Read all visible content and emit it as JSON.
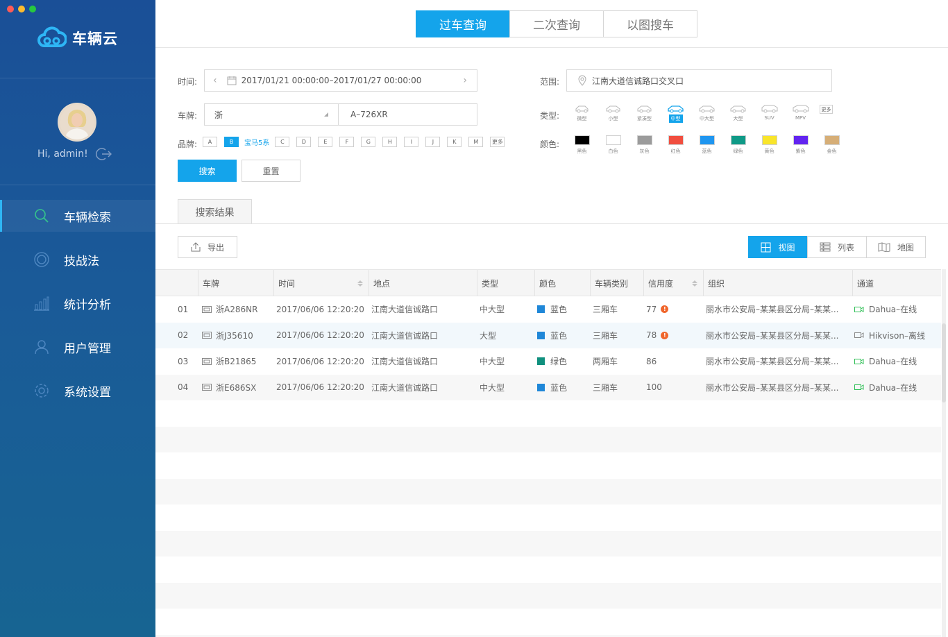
{
  "app": {
    "name": "车辆云"
  },
  "user": {
    "greeting": "Hi, admin!"
  },
  "sidebar": {
    "items": [
      {
        "label": "车辆检索",
        "icon": "search-icon"
      },
      {
        "label": "技战法",
        "icon": "target-icon"
      },
      {
        "label": "统计分析",
        "icon": "bar-chart-icon"
      },
      {
        "label": "用户管理",
        "icon": "users-icon"
      },
      {
        "label": "系统设置",
        "icon": "gear-icon"
      }
    ]
  },
  "tabs": [
    "过车查询",
    "二次查询",
    "以图搜车"
  ],
  "form": {
    "time_label": "时间:",
    "time_value": "2017/01/21 00:00:00–2017/01/27 00:00:00",
    "plate_label": "车牌:",
    "plate_province": "浙",
    "plate_number": "A–726XR",
    "brand_label": "品牌:",
    "brand_letters": [
      "A",
      "B",
      "C",
      "D",
      "E",
      "F",
      "G",
      "H",
      "I",
      "J",
      "K",
      "M"
    ],
    "brand_selected_tag": "宝马5系",
    "brand_more": "更多",
    "range_label": "范围:",
    "range_value": "江南大道信诚路口交叉口",
    "type_label": "类型:",
    "types": [
      "微型",
      "小型",
      "紧凑型",
      "中型",
      "中大型",
      "大型",
      "SUV",
      "MPV"
    ],
    "type_selected": "中型",
    "type_more": "更多",
    "color_label": "颜色:",
    "colors": [
      {
        "name": "黑色",
        "hex": "#000000"
      },
      {
        "name": "白色",
        "hex": "#ffffff"
      },
      {
        "name": "灰色",
        "hex": "#9b9b9b"
      },
      {
        "name": "红色",
        "hex": "#f14e3f"
      },
      {
        "name": "蓝色",
        "hex": "#1f96f0"
      },
      {
        "name": "绿色",
        "hex": "#0f9a87"
      },
      {
        "name": "黄色",
        "hex": "#f9e52a"
      },
      {
        "name": "紫色",
        "hex": "#6224f0"
      },
      {
        "name": "金色",
        "hex": "#d6ae77"
      }
    ],
    "search_button": "搜索",
    "reset_button": "重置"
  },
  "results": {
    "tab_label": "搜索结果",
    "export_button": "导出",
    "views": [
      "视图",
      "列表",
      "地图"
    ],
    "columns": [
      "车牌",
      "时间",
      "地点",
      "类型",
      "颜色",
      "车辆类别",
      "信用度",
      "组织",
      "通道"
    ],
    "rows": [
      {
        "no": "01",
        "plate": "浙A286NR",
        "time": "2017/06/06 12:20:20",
        "place": "江南大道信诚路口",
        "type": "中大型",
        "color": "蓝色",
        "color_hex": "#1f87d8",
        "category": "三厢车",
        "credit": "77",
        "warn": true,
        "org": "丽水市公安局–某某县区分局–某某...",
        "channel": "Dahua–在线"
      },
      {
        "no": "02",
        "plate": "浙J35610",
        "time": "2017/06/06 12:20:20",
        "place": "江南大道信诚路口",
        "type": "大型",
        "color": "蓝色",
        "color_hex": "#1f87d8",
        "category": "三厢车",
        "credit": "78",
        "warn": true,
        "org": "丽水市公安局–某某县区分局–某某...",
        "channel": "Hikvison–离线"
      },
      {
        "no": "03",
        "plate": "浙B21865",
        "time": "2017/06/06 12:20:20",
        "place": "江南大道信诚路口",
        "type": "中大型",
        "color": "绿色",
        "color_hex": "#10907e",
        "category": "两厢车",
        "credit": "86",
        "warn": false,
        "org": "丽水市公安局–某某县区分局–某某...",
        "channel": "Dahua–在线"
      },
      {
        "no": "04",
        "plate": "浙E686SX",
        "time": "2017/06/06 12:20:20",
        "place": "江南大道信诚路口",
        "type": "中大型",
        "color": "蓝色",
        "color_hex": "#1f87d8",
        "category": "三厢车",
        "credit": "100",
        "warn": false,
        "org": "丽水市公安局–某某县区分局–某某...",
        "channel": "Dahua–在线"
      }
    ]
  },
  "theme": {
    "accent": "#14a4eb",
    "sidebar": "#1a5596",
    "warning": "#f0662c",
    "online": "#2fbf56"
  }
}
